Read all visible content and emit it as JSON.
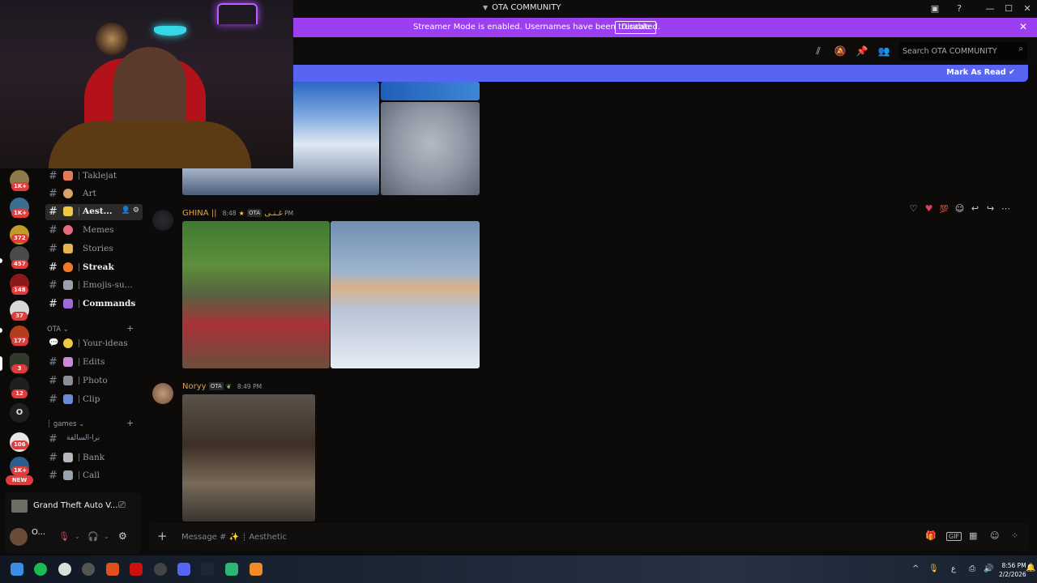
{
  "window": {
    "title": "OTA COMMUNITY",
    "controls": {
      "minimize": "—",
      "maximize": "☐",
      "close": "✕"
    }
  },
  "streamer_banner": {
    "message": "Streamer Mode is enabled. Usernames have been truncated.",
    "disable_label": "Disable"
  },
  "header": {
    "search_placeholder": "Search OTA COMMUNITY"
  },
  "new_messages_bar": {
    "mark_read_label": "Mark As Read"
  },
  "servers": {
    "badges": [
      "1K+",
      "1K+",
      "372",
      "457",
      "148",
      "37",
      "177",
      "3",
      "12",
      "106",
      "1K+"
    ],
    "letter_server": "O",
    "new_label": "NEW"
  },
  "channels": {
    "top_list": [
      {
        "label": "Taklejat",
        "bold": false
      },
      {
        "label": "Art",
        "bold": false
      },
      {
        "label": "Aest...",
        "bold": true,
        "active": true
      },
      {
        "label": "Memes",
        "bold": false
      },
      {
        "label": "Stories",
        "bold": false
      },
      {
        "label": "Streak",
        "bold": true
      },
      {
        "label": "Emojis-su...",
        "bold": false
      },
      {
        "label": "Commands",
        "bold": true
      }
    ],
    "category_ota": "OTA",
    "ota_list": [
      {
        "label": "Your-ideas"
      },
      {
        "label": "Edits"
      },
      {
        "label": "Photo"
      },
      {
        "label": "Clip"
      }
    ],
    "category_games": "games",
    "games_list": [
      {
        "label": "برا-السالفة"
      },
      {
        "label": "Bank"
      },
      {
        "label": "Call"
      }
    ]
  },
  "activity": {
    "game_name": "Grand Theft Auto V..."
  },
  "user_panel": {
    "username": "O..."
  },
  "messages": [
    {
      "author": "GHINA || غـنـى",
      "role_tag": "OTA",
      "time": "8:48 PM",
      "author_color": "#e8a33c"
    },
    {
      "author": "Noryy",
      "role_tag": "OTA",
      "time": "8:49 PM",
      "author_color": "#e8a33c"
    }
  ],
  "composer": {
    "placeholder": "Message # ✨ ┊ Aesthetic"
  },
  "taskbar": {
    "time": "8:56 PM",
    "date": "2/2/2026",
    "lang": "ع"
  }
}
